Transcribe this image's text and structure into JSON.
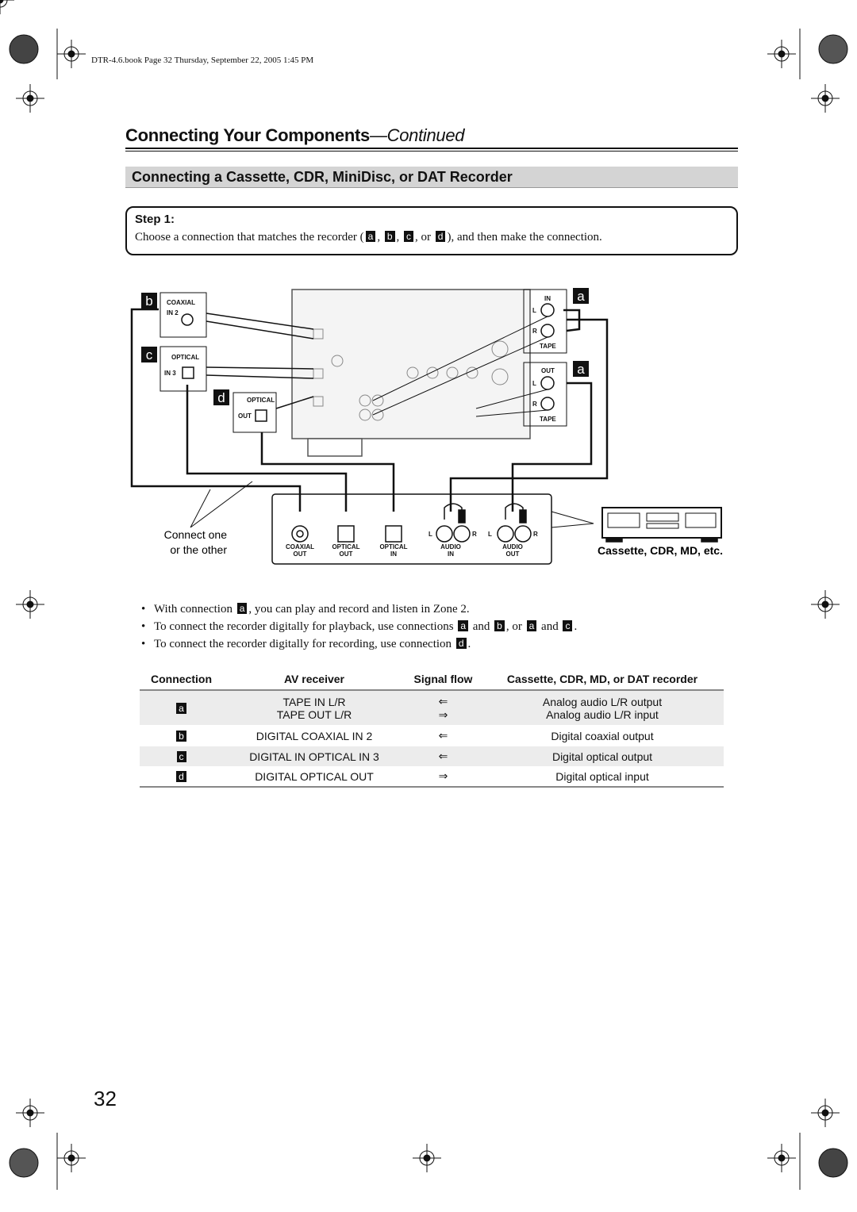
{
  "header": {
    "book_info": "DTR-4.6.book  Page 32  Thursday, September 22, 2005  1:45 PM"
  },
  "page": {
    "title": "Connecting Your Components",
    "title_suffix": "—Continued",
    "section_title": "Connecting a Cassette, CDR, MiniDisc, or DAT Recorder",
    "page_number": "32"
  },
  "step": {
    "label": "Step 1:",
    "text_before": "Choose a connection that matches the recorder (",
    "text_after": "), and then make the connection.",
    "sep1": ", ",
    "sep2": ", ",
    "sep3": ", or "
  },
  "badges": {
    "a": "a",
    "b": "b",
    "c": "c",
    "d": "d"
  },
  "diagram": {
    "coaxial": "COAXIAL",
    "in2": "IN 2",
    "optical": "OPTICAL",
    "in3": "IN 3",
    "out": "OUT",
    "in": "IN",
    "tape": "TAPE",
    "l": "L",
    "r": "R",
    "connect_one": "Connect one",
    "or_other": "or the other",
    "recorder_label": "Cassette, CDR, MD, etc.",
    "jacks": [
      {
        "top": "COAXIAL",
        "bottom": "OUT"
      },
      {
        "top": "OPTICAL",
        "bottom": "OUT"
      },
      {
        "top": "OPTICAL",
        "bottom": "IN"
      },
      {
        "top": "AUDIO",
        "bottom": "IN"
      },
      {
        "top": "AUDIO",
        "bottom": "OUT"
      }
    ]
  },
  "bullets": {
    "b1_pre": "With connection ",
    "b1_post": ", you can play and record and listen in Zone 2.",
    "b2_pre": "To connect the recorder digitally for playback, use connections ",
    "and": " and ",
    "or": ", or ",
    "b2_post": ".",
    "b3_pre": "To connect the recorder digitally for recording, use connection ",
    "b3_post": "."
  },
  "table": {
    "headers": [
      "Connection",
      "AV receiver",
      "Signal flow",
      "Cassette, CDR, MD, or DAT recorder"
    ],
    "rows": [
      {
        "conn": "a",
        "receiver": [
          "TAPE IN L/R",
          "TAPE OUT L/R"
        ],
        "flow": [
          "⇐",
          "⇒"
        ],
        "recorder": [
          "Analog audio L/R output",
          "Analog audio L/R input"
        ]
      },
      {
        "conn": "b",
        "receiver": [
          "DIGITAL COAXIAL IN 2"
        ],
        "flow": [
          "⇐"
        ],
        "recorder": [
          "Digital coaxial output"
        ]
      },
      {
        "conn": "c",
        "receiver": [
          "DIGITAL IN OPTICAL IN 3"
        ],
        "flow": [
          "⇐"
        ],
        "recorder": [
          "Digital optical output"
        ]
      },
      {
        "conn": "d",
        "receiver": [
          "DIGITAL OPTICAL OUT"
        ],
        "flow": [
          "⇒"
        ],
        "recorder": [
          "Digital optical input"
        ]
      }
    ]
  }
}
